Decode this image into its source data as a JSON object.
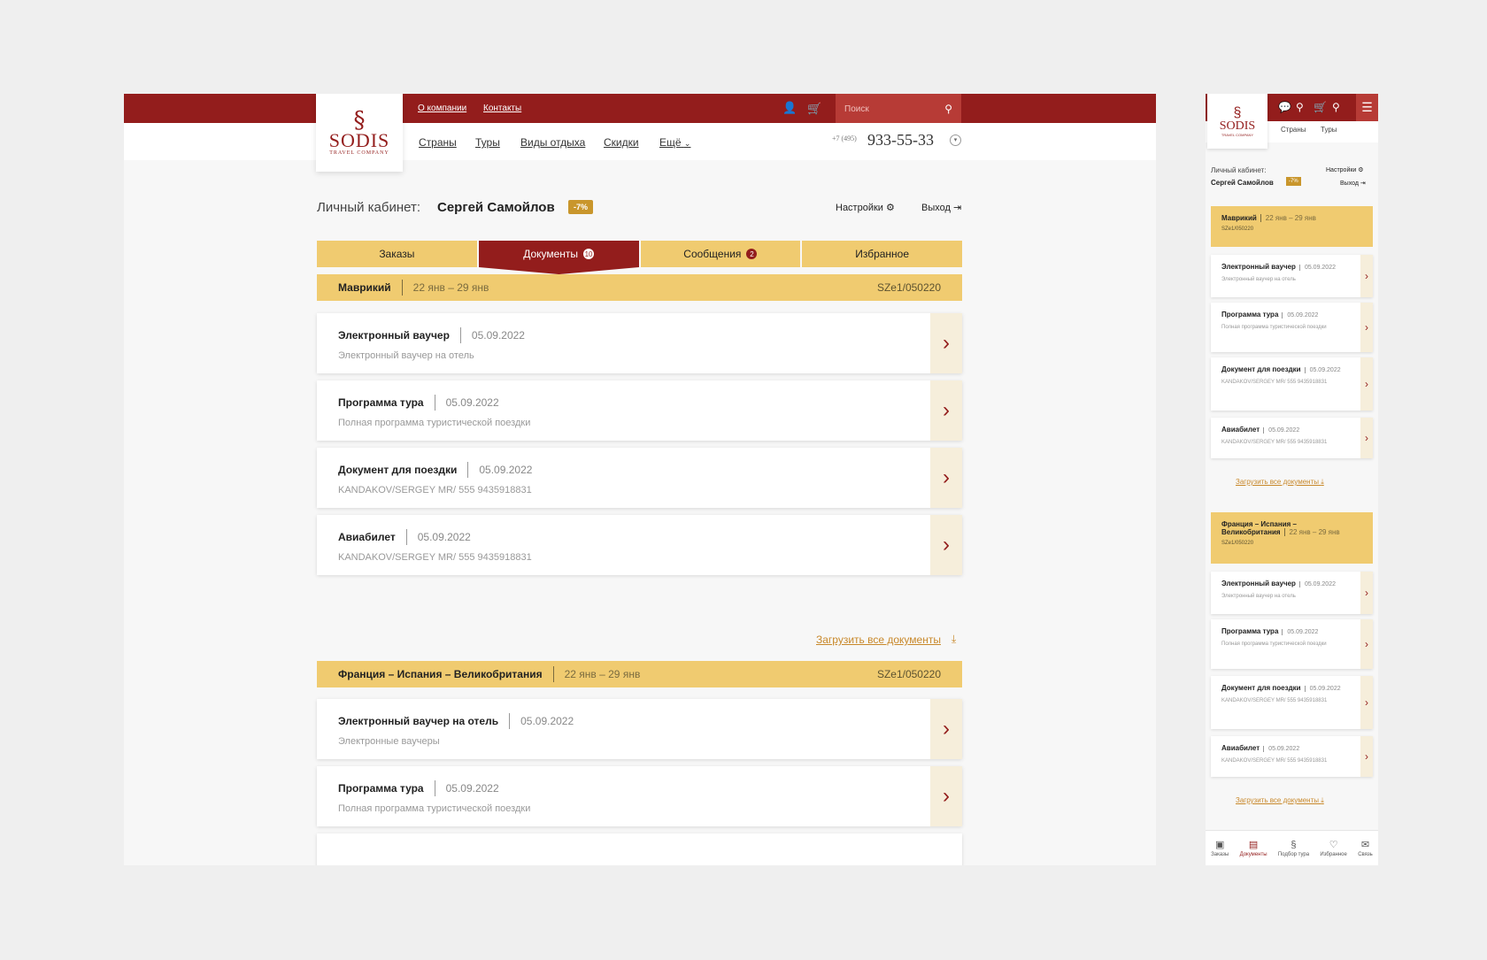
{
  "brand": {
    "logo_mark": "§",
    "name": "SODIS",
    "tagline": "TRAVEL COMPANY"
  },
  "header": {
    "top_links": [
      "О компании",
      "Контакты"
    ],
    "search_placeholder": "Поиск",
    "nav": [
      "Страны",
      "Туры",
      "Виды отдыха",
      "Скидки",
      "Ещё"
    ],
    "phone_prefix": "+7 (495)",
    "phone": "933-55-33"
  },
  "cabinet": {
    "label": "Личный кабинет:",
    "user": "Сергей Самойлов",
    "discount": "-7%",
    "settings": "Настройки",
    "logout": "Выход"
  },
  "tabs": [
    {
      "label": "Заказы",
      "count": ""
    },
    {
      "label": "Документы",
      "count": "10"
    },
    {
      "label": "Сообщения",
      "count": "2"
    },
    {
      "label": "Избранное",
      "count": ""
    }
  ],
  "groups": [
    {
      "title": "Маврикий",
      "dates": "22 янв – 29 янв",
      "code": "SZe1/050220",
      "docs": [
        {
          "title": "Электронный ваучер",
          "date": "05.09.2022",
          "desc": "Электронный ваучер на отель"
        },
        {
          "title": "Программа тура",
          "date": "05.09.2022",
          "desc": "Полная программа туристической поездки"
        },
        {
          "title": "Документ для поездки",
          "date": "05.09.2022",
          "desc": "KANDAKOV/SERGEY MR/ 555 9435918831"
        },
        {
          "title": "Авиабилет",
          "date": "05.09.2022",
          "desc": "KANDAKOV/SERGEY MR/ 555 9435918831"
        }
      ]
    },
    {
      "title": "Франция – Испания – Великобритания",
      "dates": "22 янв – 29 янв",
      "code": "SZe1/050220",
      "docs": [
        {
          "title": "Электронный ваучер на отель",
          "date": "05.09.2022",
          "desc": "Электронные ваучеры"
        },
        {
          "title": "Программа тура",
          "date": "05.09.2022",
          "desc": "Полная программа туристической поездки"
        }
      ]
    }
  ],
  "download_all": "Загрузить все документы",
  "mobile": {
    "nav": [
      "Страны",
      "Туры"
    ],
    "groups": [
      {
        "title": "Маврикий",
        "dates": "22 янв – 29 янв",
        "code": "SZe1/050220"
      },
      {
        "title": "Франция – Испания – Великобритания",
        "dates": "22 янв – 29 янв",
        "code": "SZe1/050220"
      }
    ],
    "tabbar": [
      "Заказы",
      "Документы",
      "Подбор тура",
      "Избранное",
      "Связь"
    ]
  },
  "colors": {
    "primary": "#931d1c",
    "accent": "#f0cb70",
    "link": "#c8882a"
  }
}
